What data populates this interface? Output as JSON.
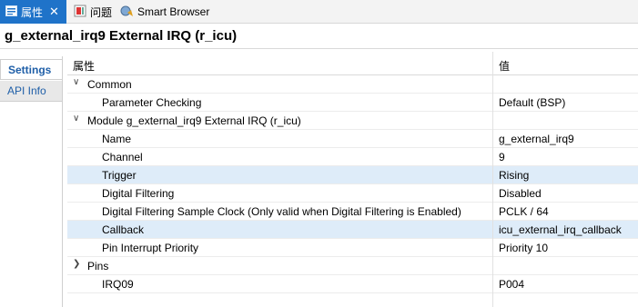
{
  "tabs": [
    {
      "label": "属性",
      "icon": "properties-icon",
      "active": true
    },
    {
      "label": "问题",
      "icon": "problems-icon",
      "active": false
    },
    {
      "label": "Smart Browser",
      "icon": "smart-browser-icon",
      "active": false
    }
  ],
  "title": "g_external_irq9 External IRQ (r_icu)",
  "side_tabs": [
    {
      "label": "Settings",
      "selected": true
    },
    {
      "label": "API Info",
      "selected": false
    }
  ],
  "table": {
    "col_property": "属性",
    "col_value": "值",
    "rows": [
      {
        "key": "Common",
        "value": "",
        "level": 0,
        "expandable": true,
        "highlight": false
      },
      {
        "key": "Parameter Checking",
        "value": "Default (BSP)",
        "level": 1,
        "expandable": false,
        "highlight": false
      },
      {
        "key": "Module g_external_irq9 External IRQ (r_icu)",
        "value": "",
        "level": 0,
        "expandable": true,
        "highlight": false
      },
      {
        "key": "Name",
        "value": "g_external_irq9",
        "level": 1,
        "expandable": false,
        "highlight": false
      },
      {
        "key": "Channel",
        "value": "9",
        "level": 1,
        "expandable": false,
        "highlight": false
      },
      {
        "key": "Trigger",
        "value": "Rising",
        "level": 1,
        "expandable": false,
        "highlight": true
      },
      {
        "key": "Digital Filtering",
        "value": "Disabled",
        "level": 1,
        "expandable": false,
        "highlight": false
      },
      {
        "key": "Digital Filtering Sample Clock (Only valid when Digital Filtering is Enabled)",
        "value": "PCLK / 64",
        "level": 1,
        "expandable": false,
        "highlight": false
      },
      {
        "key": "Callback",
        "value": "icu_external_irq_callback",
        "level": 1,
        "expandable": false,
        "highlight": true
      },
      {
        "key": "Pin Interrupt Priority",
        "value": "Priority 10",
        "level": 1,
        "expandable": false,
        "highlight": false
      },
      {
        "key": "Pins",
        "value": "",
        "level": 0,
        "expandable": true,
        "highlight": false
      },
      {
        "key": "IRQ09",
        "value": "P004",
        "level": 1,
        "expandable": false,
        "highlight": false
      }
    ]
  },
  "colors": {
    "accent": "#1f73c9",
    "row_highlight": "#deecf9"
  }
}
